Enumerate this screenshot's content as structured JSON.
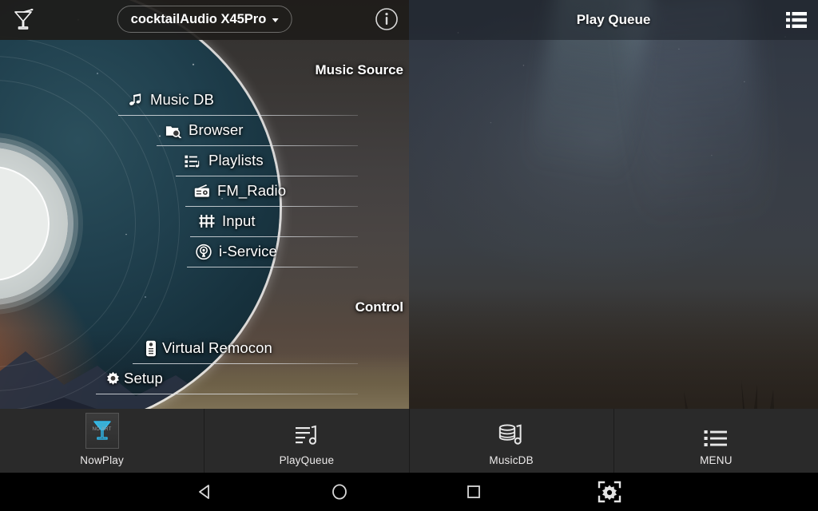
{
  "left_panel": {
    "topbar": {
      "logo_icon": "cocktail-glass-icon",
      "device_name": "cocktailAudio X45Pro",
      "dropdown_icon": "caret-down-icon",
      "info_icon": "info-circle-icon"
    },
    "sections": [
      {
        "title": "Music Source"
      },
      {
        "title": "Control"
      }
    ],
    "music_source_items": [
      {
        "label": "Music DB",
        "icon": "music-note-icon"
      },
      {
        "label": "Browser",
        "icon": "folder-search-icon"
      },
      {
        "label": "Playlists",
        "icon": "playlist-note-icon"
      },
      {
        "label": "FM_Radio",
        "icon": "radio-icon"
      },
      {
        "label": "Input",
        "icon": "sliders-icon"
      },
      {
        "label": "i-Service",
        "icon": "broadcast-icon"
      }
    ],
    "control_items": [
      {
        "label": "Virtual Remocon",
        "icon": "remote-control-icon"
      },
      {
        "label": "Setup",
        "icon": "gear-icon"
      }
    ]
  },
  "right_panel": {
    "title": "Play Queue",
    "menu_icon": "list-menu-icon"
  },
  "tabbar": {
    "tabs": [
      {
        "label": "NowPlay",
        "icon": "album-art-placeholder-icon",
        "art_text": "NO ART"
      },
      {
        "label": "PlayQueue",
        "icon": "queue-note-icon"
      },
      {
        "label": "MusicDB",
        "icon": "database-note-icon"
      },
      {
        "label": "MENU",
        "icon": "hamburger-list-icon"
      }
    ]
  },
  "navbar": {
    "buttons": [
      {
        "name": "back",
        "icon": "triangle-back-icon"
      },
      {
        "name": "home",
        "icon": "circle-home-icon"
      },
      {
        "name": "recents",
        "icon": "square-recents-icon"
      },
      {
        "name": "screenshot",
        "icon": "gear-in-brackets-icon"
      }
    ]
  },
  "colors": {
    "tabbar_bg": "#2a2a2a",
    "navbar_bg": "#000000",
    "text": "#ffffff",
    "separator": "#e1e4e8"
  }
}
